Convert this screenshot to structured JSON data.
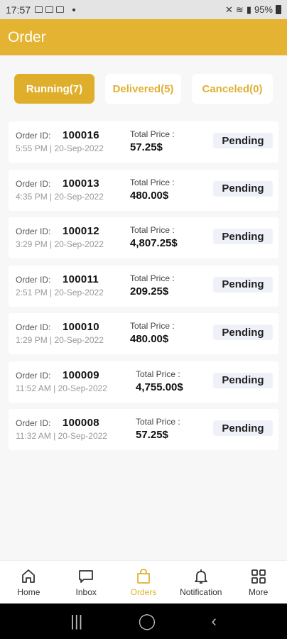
{
  "status_bar": {
    "time": "17:57",
    "battery": "95%"
  },
  "header": {
    "title": "Order"
  },
  "tabs": [
    {
      "label": "Running(7)",
      "active": true
    },
    {
      "label": "Delivered(5)",
      "active": false
    },
    {
      "label": "Canceled(0)",
      "active": false
    }
  ],
  "labels": {
    "order_id": "Order ID:",
    "total_price": "Total Price :"
  },
  "orders": [
    {
      "id": "100016",
      "time": "5:55 PM | 20-Sep-2022",
      "price": "57.25$",
      "status": "Pending"
    },
    {
      "id": "100013",
      "time": "4:35 PM | 20-Sep-2022",
      "price": "480.00$",
      "status": "Pending"
    },
    {
      "id": "100012",
      "time": "3:29 PM | 20-Sep-2022",
      "price": "4,807.25$",
      "status": "Pending"
    },
    {
      "id": "100011",
      "time": "2:51 PM | 20-Sep-2022",
      "price": "209.25$",
      "status": "Pending"
    },
    {
      "id": "100010",
      "time": "1:29 PM | 20-Sep-2022",
      "price": "480.00$",
      "status": "Pending"
    },
    {
      "id": "100009",
      "time": "11:52 AM | 20-Sep-2022",
      "price": "4,755.00$",
      "status": "Pending"
    },
    {
      "id": "100008",
      "time": "11:32 AM | 20-Sep-2022",
      "price": "57.25$",
      "status": "Pending"
    }
  ],
  "bottom_nav": [
    {
      "label": "Home",
      "icon": "home-icon"
    },
    {
      "label": "Inbox",
      "icon": "chat-icon"
    },
    {
      "label": "Orders",
      "icon": "bag-icon",
      "active": true
    },
    {
      "label": "Notification",
      "icon": "bell-icon"
    },
    {
      "label": "More",
      "icon": "grid-icon"
    }
  ],
  "colors": {
    "accent": "#e4b331",
    "active_tab": "#dfae2a",
    "badge_bg": "#eef2f8"
  }
}
